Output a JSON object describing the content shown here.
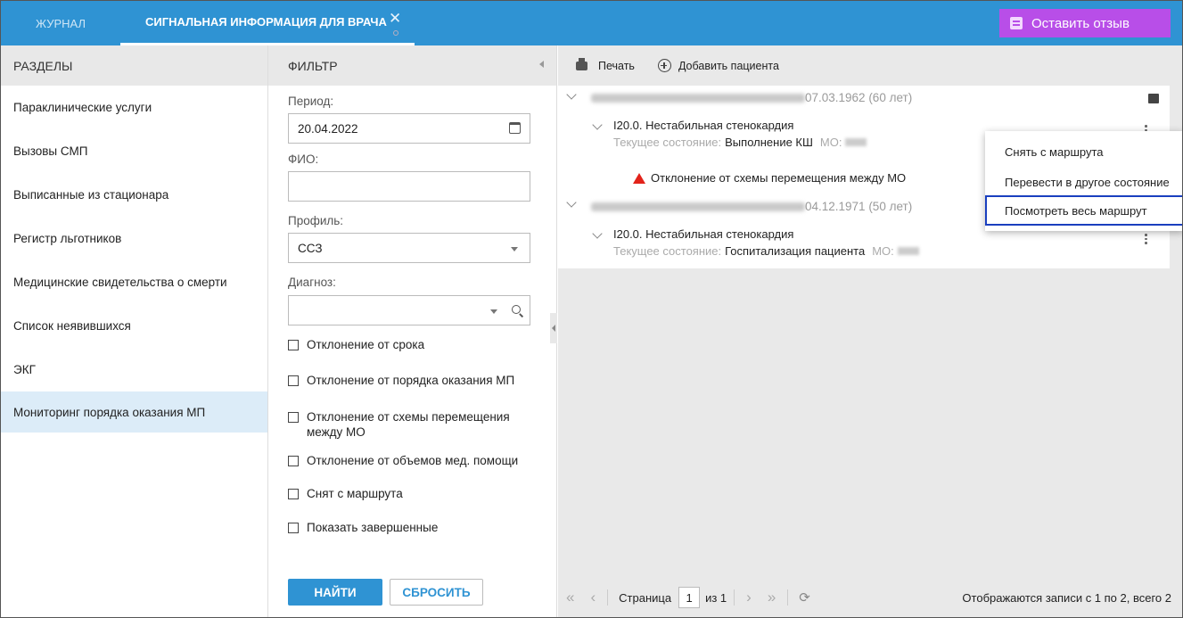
{
  "tabs": {
    "journal": "ЖУРНАЛ",
    "signal": "СИГНАЛЬНАЯ ИНФОРМАЦИЯ ДЛЯ ВРАЧА"
  },
  "feedback": {
    "label": "Оставить отзыв",
    "color": "#b84ee8"
  },
  "sidebar": {
    "title": "РАЗДЕЛЫ",
    "items": [
      {
        "label": "Параклинические услуги"
      },
      {
        "label": "Вызовы СМП"
      },
      {
        "label": "Выписанные из стационара"
      },
      {
        "label": "Регистр льготников"
      },
      {
        "label": "Медицинские свидетельства о смерти"
      },
      {
        "label": "Список неявившихся"
      },
      {
        "label": "ЭКГ"
      },
      {
        "label": "Мониторинг порядка оказания МП",
        "active": true
      }
    ]
  },
  "filter": {
    "title": "ФИЛЬТР",
    "period_label": "Период:",
    "period_value": "20.04.2022",
    "fio_label": "ФИО:",
    "fio_value": "",
    "profile_label": "Профиль:",
    "profile_value": "ССЗ",
    "diagnosis_label": "Диагноз:",
    "diagnosis_value": "",
    "checkboxes": [
      {
        "label": "Отклонение от срока",
        "checked": false
      },
      {
        "label": "Отклонение от порядка оказания МП",
        "checked": false
      },
      {
        "label": "Отклонение от схемы перемещения между МО",
        "checked": false
      },
      {
        "label": "Отклонение от объемов мед. помощи",
        "checked": false
      },
      {
        "label": "Снят с маршрута",
        "checked": false
      },
      {
        "label": "Показать завершенные",
        "checked": false
      }
    ],
    "find_label": "НАЙТИ",
    "reset_label": "СБРОСИТЬ"
  },
  "toolbar": {
    "print_label": "Печать",
    "add_patient_label": "Добавить пациента"
  },
  "patients": [
    {
      "dob": "07.03.1962 (60 лет)",
      "diagnosis": "I20.0. Нестабильная стенокардия",
      "state_label": "Текущее состояние:",
      "state_value": "Выполнение КШ",
      "mo_label": "МО:",
      "warning": "Отклонение от схемы перемещения между МО"
    },
    {
      "dob": "04.12.1971 (50 лет)",
      "diagnosis": "I20.0. Нестабильная стенокардия",
      "state_label": "Текущее состояние:",
      "state_value": "Госпитализация пациента",
      "mo_label": "МО:"
    }
  ],
  "context_menu": {
    "items": [
      {
        "label": "Снять с маршрута"
      },
      {
        "label": "Перевести в другое состояние"
      },
      {
        "label": "Посмотреть весь маршрут",
        "highlighted": true
      }
    ]
  },
  "pager": {
    "page_label": "Страница",
    "page_value": "1",
    "of_label": "из 1",
    "records_info": "Отображаются записи с 1 по 2, всего 2"
  },
  "colors": {
    "header": "#2f93d3",
    "accent": "#2f93d3",
    "active_item_bg": "#dcecf8",
    "warning": "#e2231a",
    "highlight_border": "#1a3fbf"
  }
}
